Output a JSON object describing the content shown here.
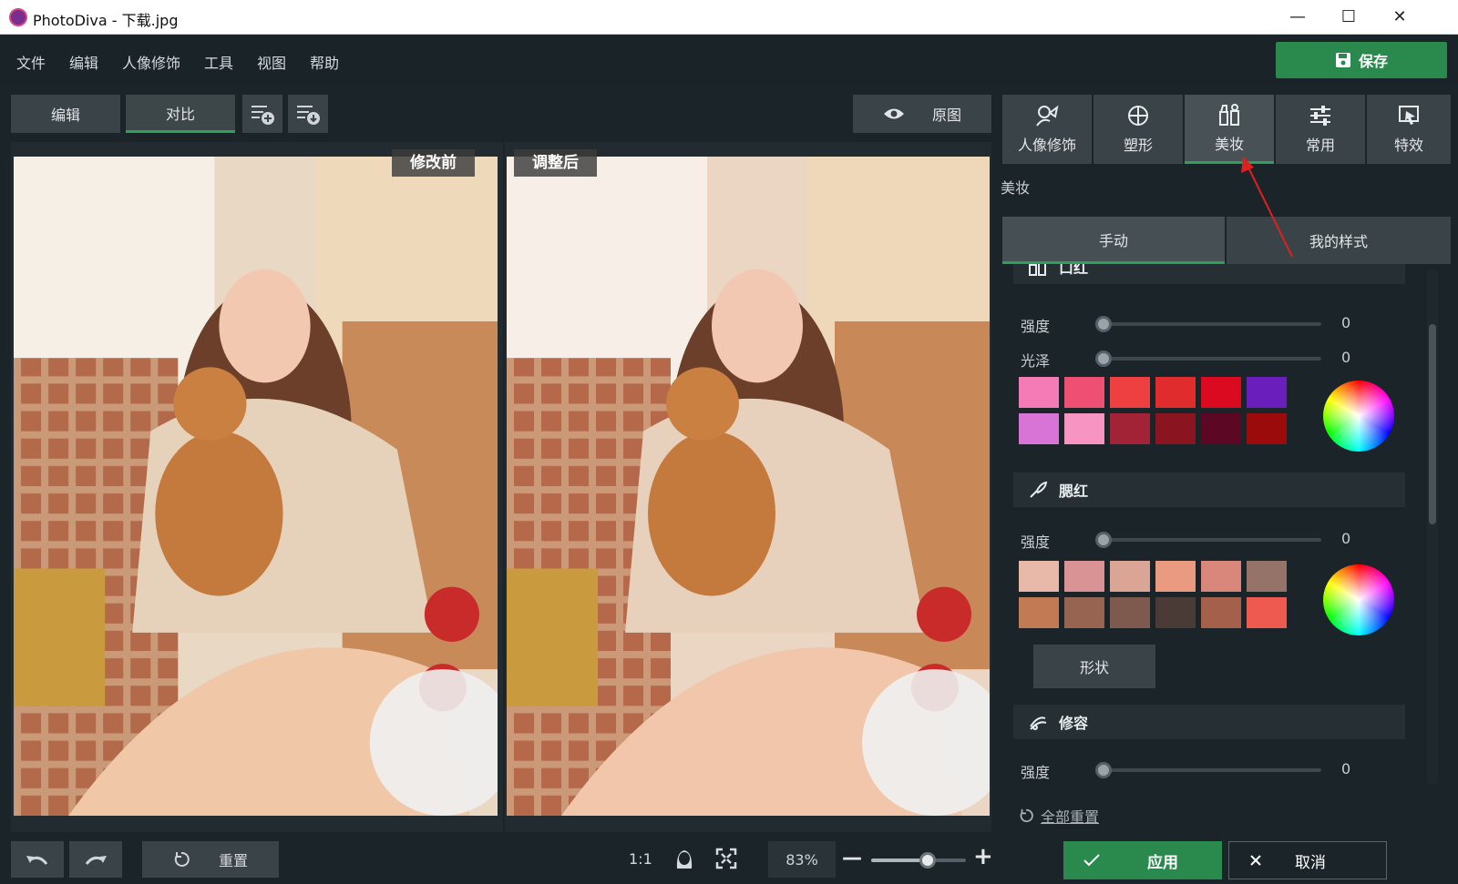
{
  "window": {
    "title": "PhotoDiva - 下载.jpg",
    "minimize": "—",
    "maximize": "☐",
    "close": "✕"
  },
  "menu": [
    "文件",
    "编辑",
    "人像修饰",
    "工具",
    "视图",
    "帮助"
  ],
  "save_label": "保存",
  "toolbar": {
    "edit": "编辑",
    "compare": "对比",
    "original": "原图"
  },
  "compare": {
    "before": "修改前",
    "after": "调整后"
  },
  "bottom": {
    "reset": "重置",
    "ratio": "1:1",
    "zoom": "83%",
    "zoom_level": 0.6
  },
  "right_tabs": [
    {
      "label": "人像修饰",
      "icon": "portrait-icon"
    },
    {
      "label": "塑形",
      "icon": "reshape-icon"
    },
    {
      "label": "美妆",
      "icon": "makeup-icon"
    },
    {
      "label": "常用",
      "icon": "sliders-icon"
    },
    {
      "label": "特效",
      "icon": "effects-icon"
    }
  ],
  "panel": {
    "section": "美妆",
    "subtabs": {
      "manual": "手动",
      "my_styles": "我的样式"
    },
    "lipstick": {
      "title": "口红",
      "sliders": [
        {
          "label": "强度",
          "value": "0"
        },
        {
          "label": "光泽",
          "value": "0"
        }
      ],
      "colors": [
        "#f47bb5",
        "#ef4f72",
        "#ee4040",
        "#e12c2e",
        "#dc0a21",
        "#6a1fbd",
        "#d774d6",
        "#f894c1",
        "#a12335",
        "#8a1520",
        "#5c0824",
        "#9b0b0b"
      ]
    },
    "blush": {
      "title": "腮红",
      "sliders": [
        {
          "label": "强度",
          "value": "0"
        }
      ],
      "colors": [
        "#e8b8a8",
        "#d99395",
        "#dba596",
        "#e99a80",
        "#d8877a",
        "#967368",
        "#c27a55",
        "#966450",
        "#7e5a4e",
        "#4a3b37",
        "#a4604a",
        "#ef5a50"
      ],
      "shape_label": "形状"
    },
    "contour": {
      "title": "修容",
      "sliders": [
        {
          "label": "强度",
          "value": "0"
        }
      ]
    },
    "reset_all": "全部重置"
  },
  "actions": {
    "apply": "应用",
    "cancel": "取消"
  }
}
